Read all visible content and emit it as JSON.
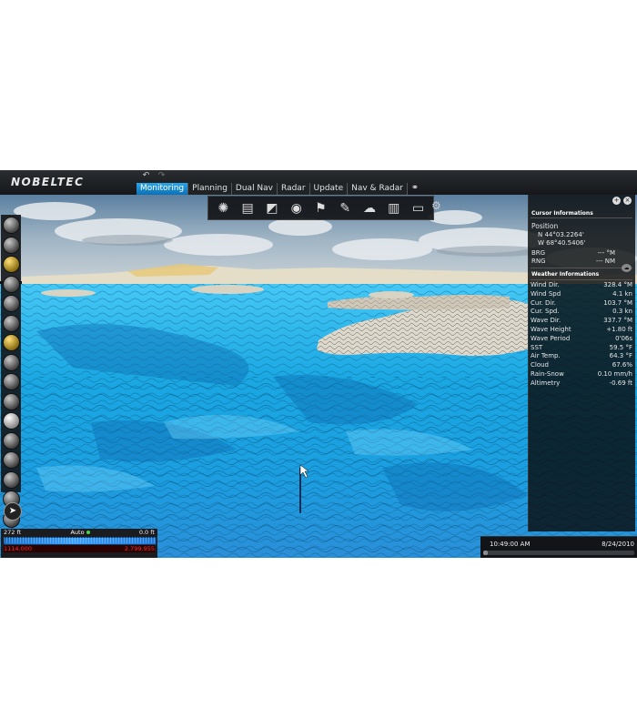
{
  "app": {
    "logo": "NOBELTEC"
  },
  "topbar": {
    "undo_icon": "undo-arrow-icon",
    "redo_icon": "redo-arrow-icon"
  },
  "tabs": [
    {
      "label": "Monitoring",
      "active": true
    },
    {
      "label": "Planning"
    },
    {
      "label": "Dual Nav"
    },
    {
      "label": "Radar"
    },
    {
      "label": "Update"
    },
    {
      "label": "Nav & Radar"
    }
  ],
  "tab_extra_icon": "link-icon",
  "toolbar": {
    "icons": [
      "compass-rose-icon",
      "route-list-icon",
      "chart-tools-icon",
      "sonar-icon",
      "waypoint-icon",
      "pencil-icon",
      "weather-icon",
      "book-icon",
      "flag-icon"
    ],
    "settings_icon": "gear-icon"
  },
  "left_tools": {
    "icons": [
      "zoom-in-icon",
      "zoom-out-icon",
      "tide-icon",
      "current-icon",
      "ruler-icon",
      "range-icon",
      "hand-icon",
      "route-icon",
      "track-icon",
      "mark-icon",
      "circle-icon",
      "target-icon",
      "measure-icon",
      "search-icon",
      "layer-icon",
      "settings-icon"
    ]
  },
  "panel": {
    "cursor_header": "Cursor Informations",
    "position_label": "Position",
    "lat": "N 44°03.2264'",
    "lon": "W 68°40.5406'",
    "brg_label": "BRG",
    "brg_value": "--- °M",
    "rng_label": "RNG",
    "rng_value": "--- NM",
    "weather_header": "Weather Informations",
    "weather": [
      {
        "label": "Wind Dir.",
        "value": "328.4 °M"
      },
      {
        "label": "Wind Spd",
        "value": "4.1 kn"
      },
      {
        "label": "Cur. Dir.",
        "value": "103.7 °M"
      },
      {
        "label": "Cur. Spd.",
        "value": "0.3 kn"
      },
      {
        "label": "Wave Dir.",
        "value": "337.7 °M"
      },
      {
        "label": "Wave Height",
        "value": "+1.80 ft"
      },
      {
        "label": "Wave Period",
        "value": "0'06s"
      },
      {
        "label": "SST",
        "value": "59.5 °F"
      },
      {
        "label": "Air Temp.",
        "value": "64.3 °F"
      },
      {
        "label": "Cloud",
        "value": "67.6%"
      },
      {
        "label": "Rain-Snow",
        "value": "0.10 mm/h"
      },
      {
        "label": "Altimetry",
        "value": "-0.69 ft"
      }
    ]
  },
  "gauge": {
    "left": "272 ft",
    "mode": "Auto",
    "right": "0.0 ft",
    "bottom_left": "1114.000",
    "bottom_right": "2.799.955"
  },
  "timebar": {
    "time": "10:49:00 AM",
    "date": "8/24/2010",
    "progress": 0.02
  },
  "colors": {
    "accent": "#1a8fd6",
    "sea": "#1fb3ea",
    "terrain": "#ddd8cc"
  }
}
